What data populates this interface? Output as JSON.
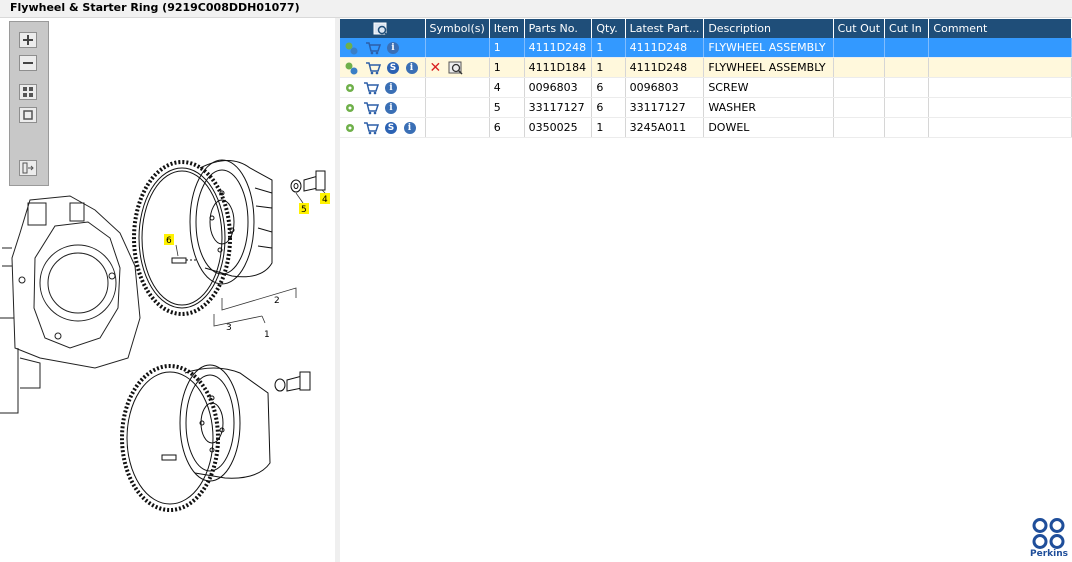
{
  "window": {
    "title": "Flywheel & Starter Ring (9219C008DDH01077)"
  },
  "diagram": {
    "callouts": [
      "4",
      "5",
      "6",
      "2",
      "3",
      "1"
    ]
  },
  "grid": {
    "headers": {
      "symbols": "Symbol(s)",
      "item": "Item",
      "parts_no": "Parts No.",
      "qty": "Qty.",
      "latest_part": "Latest Part...",
      "description": "Description",
      "cut_out": "Cut Out",
      "cut_in": "Cut In",
      "comment": "Comment"
    },
    "rows": [
      {
        "item": "1",
        "parts_no": "4111D248",
        "qty": "1",
        "latest_part": "4111D248",
        "description": "FLYWHEEL ASSEMBLY",
        "cut_out": "",
        "cut_in": "",
        "comment": ""
      },
      {
        "item": "1",
        "parts_no": "4111D184",
        "qty": "1",
        "latest_part": "4111D248",
        "description": "FLYWHEEL ASSEMBLY",
        "cut_out": "",
        "cut_in": "",
        "comment": ""
      },
      {
        "item": "4",
        "parts_no": "0096803",
        "qty": "6",
        "latest_part": "0096803",
        "description": "SCREW",
        "cut_out": "",
        "cut_in": "",
        "comment": ""
      },
      {
        "item": "5",
        "parts_no": "33117127",
        "qty": "6",
        "latest_part": "33117127",
        "description": "WASHER",
        "cut_out": "",
        "cut_in": "",
        "comment": ""
      },
      {
        "item": "6",
        "parts_no": "0350025",
        "qty": "1",
        "latest_part": "3245A011",
        "description": "DOWEL",
        "cut_out": "",
        "cut_in": "",
        "comment": ""
      }
    ]
  },
  "brand": {
    "name": "Perkins",
    "color": "#1f4e9a"
  },
  "colors": {
    "header_bg": "#1f4e79",
    "selected_row": "#3399ff",
    "highlight_row": "#fff8dc"
  }
}
